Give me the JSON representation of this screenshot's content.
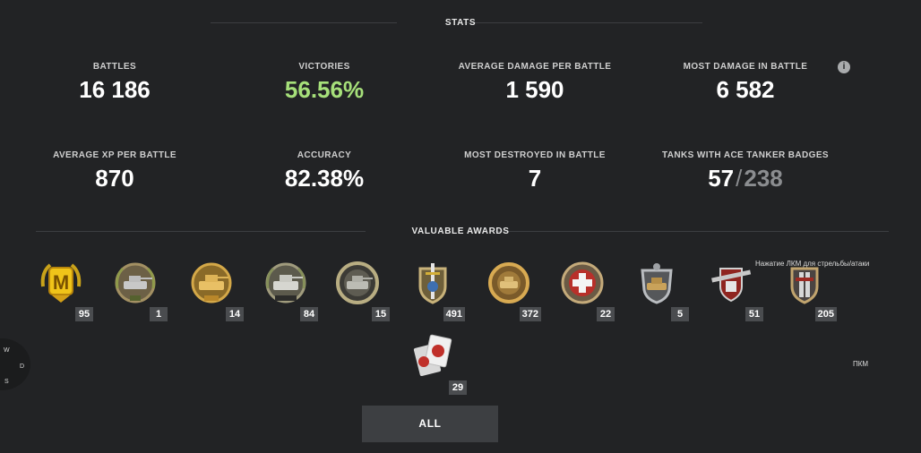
{
  "stats_section": {
    "title": "STATS"
  },
  "stats": [
    {
      "label": "BATTLES",
      "value": "16 186"
    },
    {
      "label": "VICTORIES",
      "value": "56.56%"
    },
    {
      "label": "AVERAGE DAMAGE PER BATTLE",
      "value": "1 590"
    },
    {
      "label": "MOST DAMAGE IN BATTLE",
      "value": "6 582"
    },
    {
      "label": "AVERAGE XP PER BATTLE",
      "value": "870"
    },
    {
      "label": "ACCURACY",
      "value": "82.38%"
    },
    {
      "label": "MOST DESTROYED IN BATTLE",
      "value": "7"
    },
    {
      "label": "TANKS WITH ACE TANKER BADGES",
      "value": "57",
      "separator": "/",
      "total": "238"
    }
  ],
  "colors": {
    "background": "#222325",
    "victories": "#a6e07a",
    "muted": "#8b8d90",
    "count_badge": "#4a4c4f"
  },
  "awards_section": {
    "title": "VALUABLE AWARDS"
  },
  "awards": [
    {
      "icon": "mastery-m-badge-icon",
      "count": "95"
    },
    {
      "icon": "tank-medal-1-icon",
      "count": "1"
    },
    {
      "icon": "tank-medal-2-icon",
      "count": "14"
    },
    {
      "icon": "tank-medal-3-icon",
      "count": "84"
    },
    {
      "icon": "tank-medal-4-icon",
      "count": "15"
    },
    {
      "icon": "sword-shield-medal-icon",
      "count": "491"
    },
    {
      "icon": "tank-medal-5-icon",
      "count": "372"
    },
    {
      "icon": "red-cross-medal-icon",
      "count": "22"
    },
    {
      "icon": "tank-medal-6-icon",
      "count": "5"
    },
    {
      "icon": "cannon-shield-medal-icon",
      "count": "51"
    },
    {
      "icon": "tank-medal-7-icon",
      "count": "205"
    },
    {
      "icon": "cards-award-icon",
      "count": "29"
    }
  ],
  "all_button": {
    "label": "ALL"
  },
  "hints": {
    "tooltip": "Нажатие ЛКМ для стрельбы/атаки",
    "mouse_label": "ПКМ"
  },
  "compass": {
    "w": "W",
    "d": "D",
    "s": "S"
  }
}
